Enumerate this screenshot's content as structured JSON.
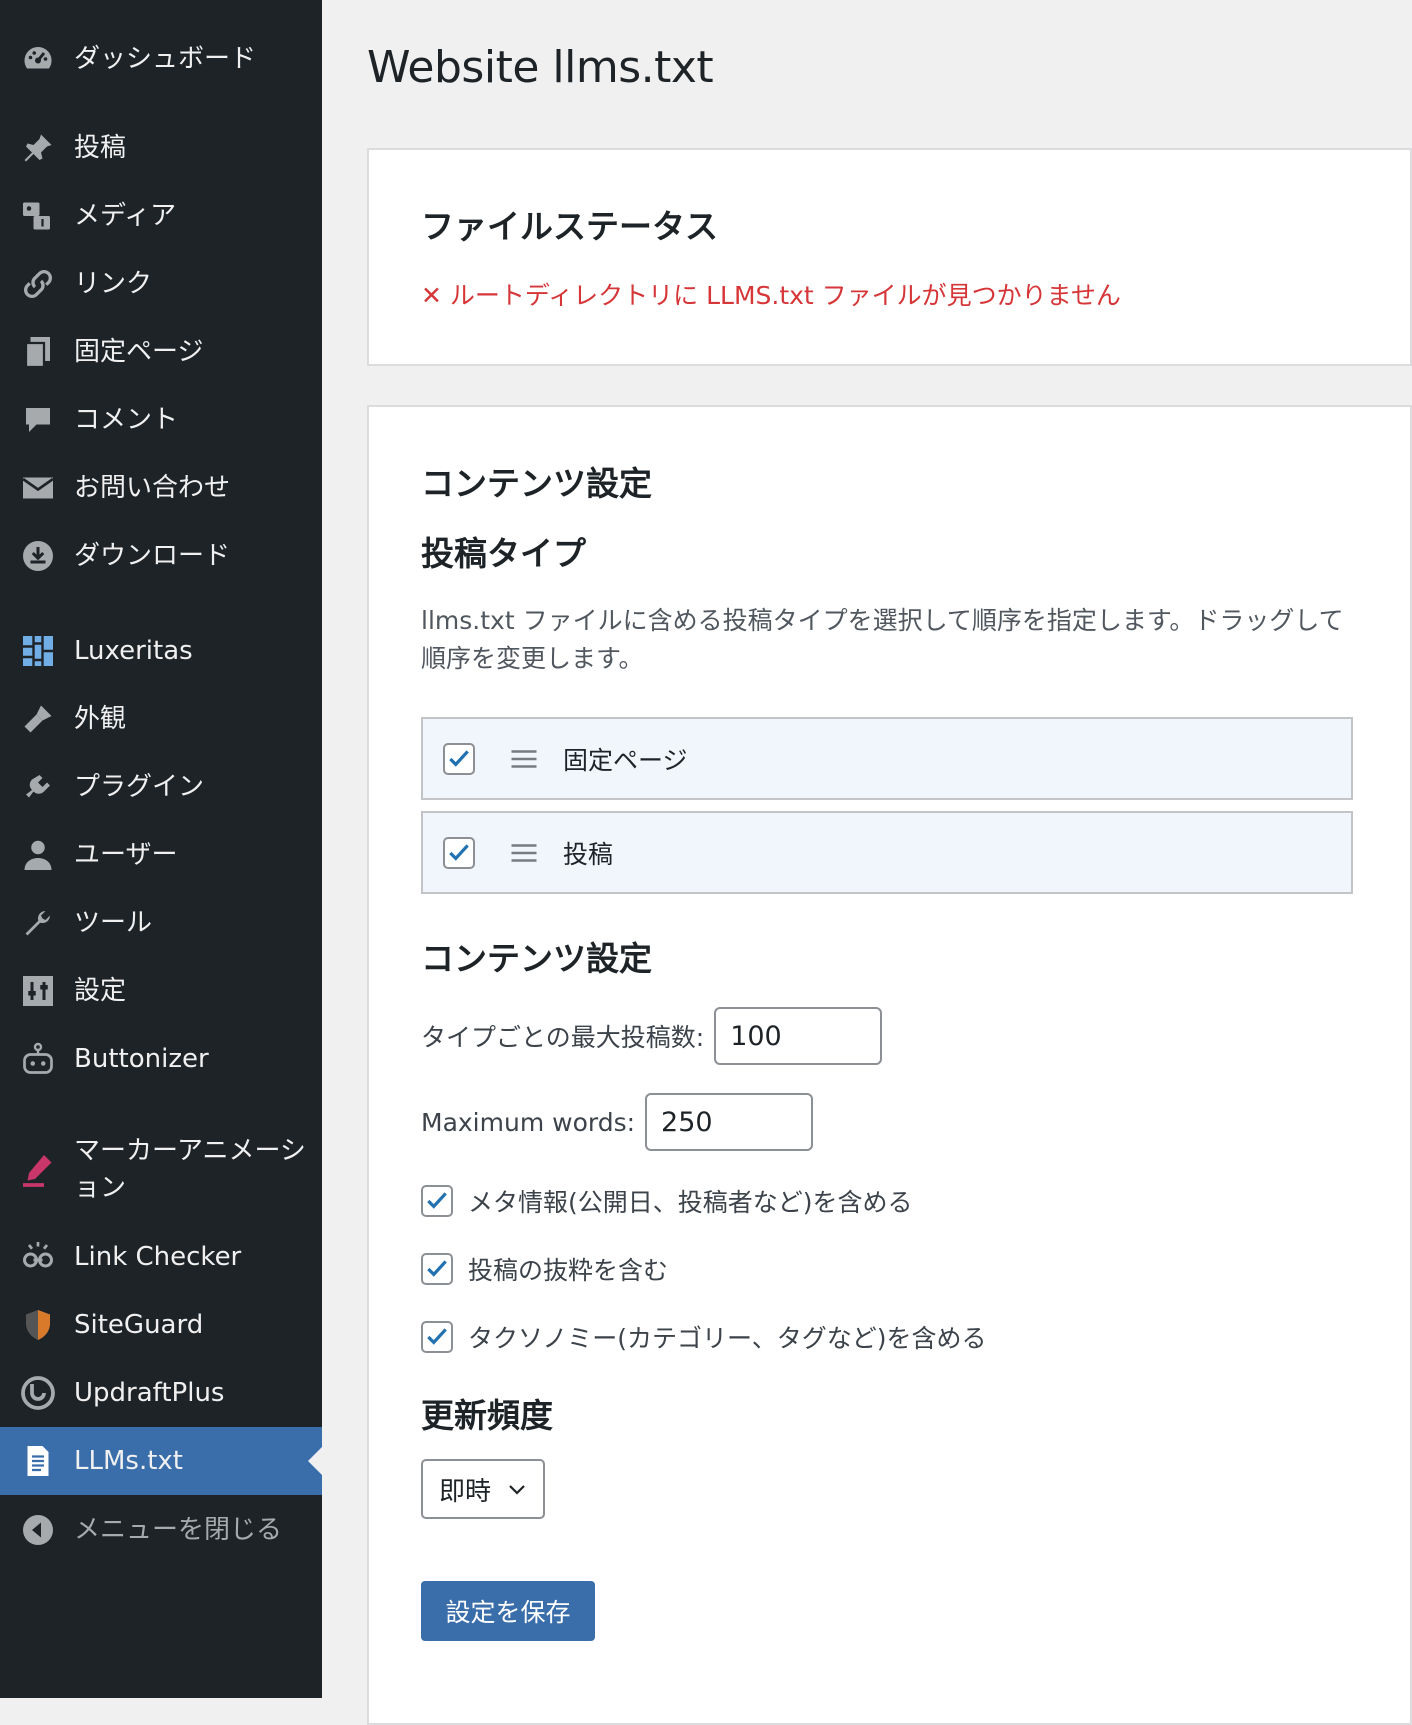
{
  "sidebar": {
    "items": [
      {
        "label": "ダッシュボード",
        "icon": "dashboard-icon"
      },
      {
        "label": "投稿",
        "icon": "pin-icon"
      },
      {
        "label": "メディア",
        "icon": "media-icon"
      },
      {
        "label": "リンク",
        "icon": "link-icon"
      },
      {
        "label": "固定ページ",
        "icon": "pages-icon"
      },
      {
        "label": "コメント",
        "icon": "comment-icon"
      },
      {
        "label": "お問い合わせ",
        "icon": "mail-icon"
      },
      {
        "label": "ダウンロード",
        "icon": "download-icon"
      },
      {
        "label": "Luxeritas",
        "icon": "grid-icon"
      },
      {
        "label": "外観",
        "icon": "brush-icon"
      },
      {
        "label": "プラグイン",
        "icon": "plugin-icon"
      },
      {
        "label": "ユーザー",
        "icon": "user-icon"
      },
      {
        "label": "ツール",
        "icon": "wrench-icon"
      },
      {
        "label": "設定",
        "icon": "settings-icon"
      },
      {
        "label": "Buttonizer",
        "icon": "robot-icon"
      },
      {
        "label": "マーカーアニメーション",
        "icon": "marker-icon"
      },
      {
        "label": "Link Checker",
        "icon": "link-checker-icon"
      },
      {
        "label": "SiteGuard",
        "icon": "shield-icon"
      },
      {
        "label": "UpdraftPlus",
        "icon": "updraft-icon"
      },
      {
        "label": "LLMs.txt",
        "icon": "document-icon"
      },
      {
        "label": "メニューを閉じる",
        "icon": "collapse-icon"
      }
    ],
    "active_index": 19,
    "active_color": "#3a6eaa"
  },
  "page": {
    "title": "Website llms.txt"
  },
  "status_card": {
    "heading": "ファイルステータス",
    "error": "✕ ルートディレクトリに LLMS.txt ファイルが見つかりません",
    "error_color": "#d63638"
  },
  "settings_card": {
    "heading": "コンテンツ設定",
    "post_types_heading": "投稿タイプ",
    "post_types_description": "llms.txt ファイルに含める投稿タイプを選択して順序を指定します。ドラッグして順序を変更します。",
    "post_types": [
      {
        "label": "固定ページ",
        "checked": true
      },
      {
        "label": "投稿",
        "checked": true
      }
    ],
    "content_heading": "コンテンツ設定",
    "max_posts_label": "タイプごとの最大投稿数:",
    "max_posts_value": "100",
    "max_words_label": "Maximum words:",
    "max_words_value": "250",
    "options": [
      {
        "label": "メタ情報(公開日、投稿者など)を含める",
        "checked": true
      },
      {
        "label": "投稿の抜粋を含む",
        "checked": true
      },
      {
        "label": "タクソノミー(カテゴリー、タグなど)を含める",
        "checked": true
      }
    ],
    "frequency_heading": "更新頻度",
    "frequency_value": "即時",
    "save_label": "設定を保存"
  }
}
